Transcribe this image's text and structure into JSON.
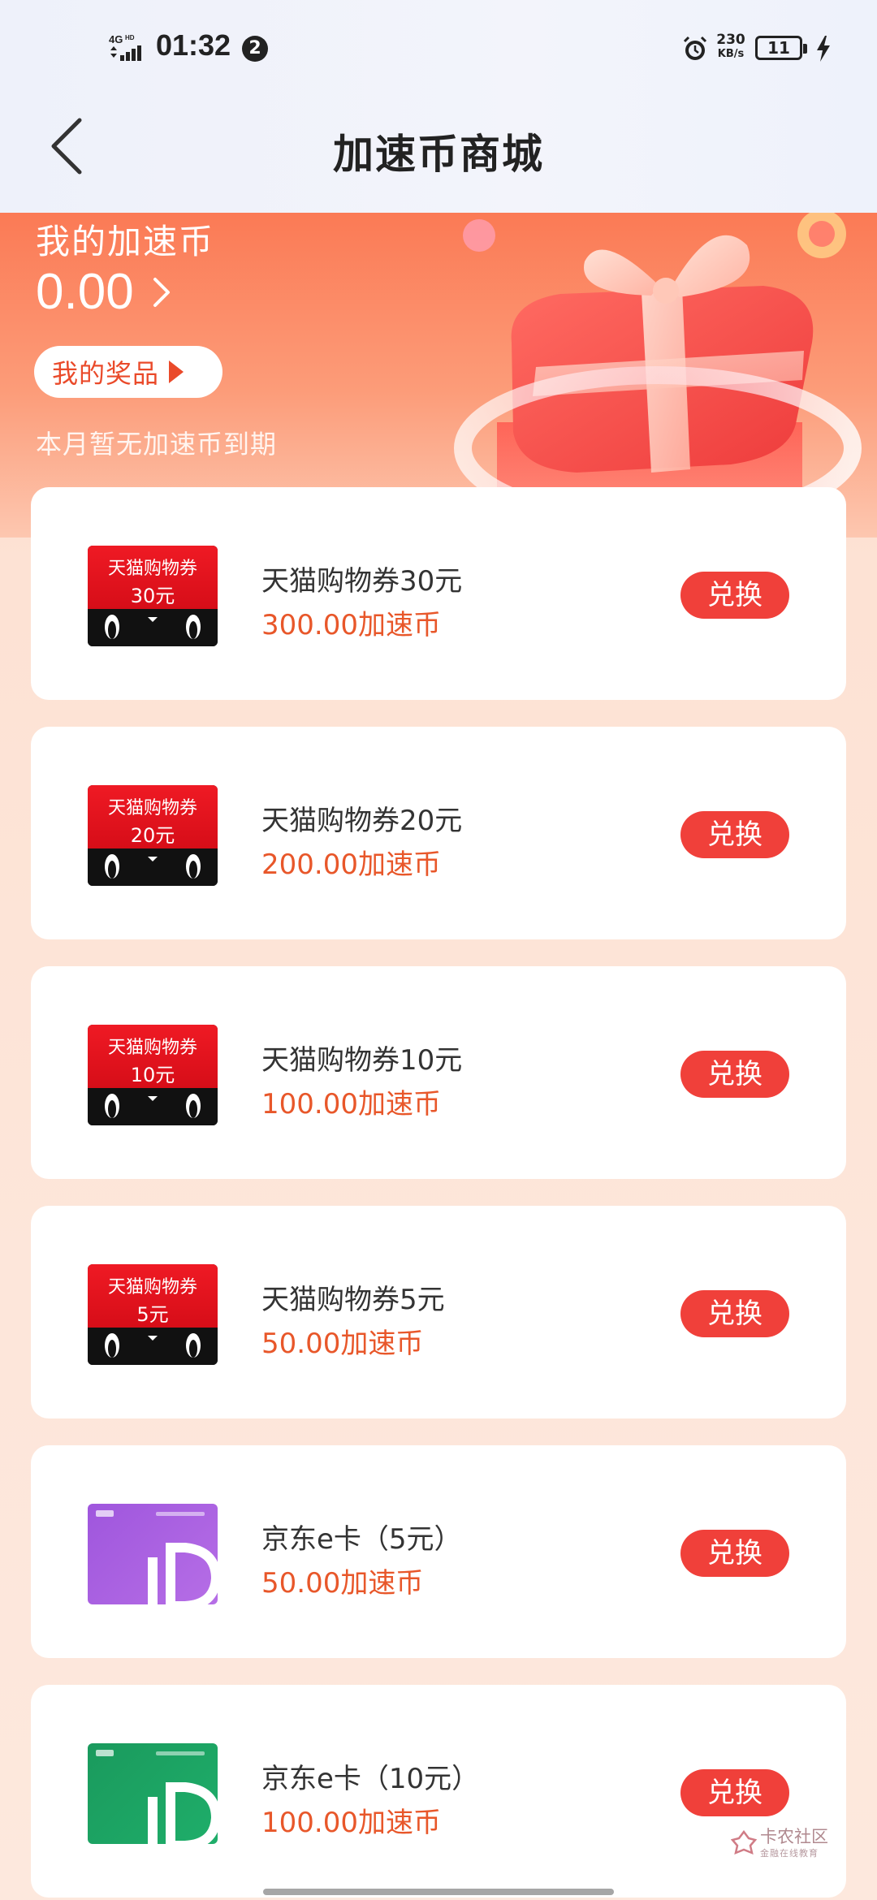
{
  "status_bar": {
    "network": "4GHD",
    "time": "01:32",
    "notification_count": "2",
    "speed_value": "230",
    "speed_unit": "KB/s",
    "battery": "11",
    "icons": [
      "signal-icon",
      "alarm-icon",
      "battery-icon",
      "charging-icon"
    ]
  },
  "header": {
    "title": "加速币商城",
    "back_icon": "chevron-left-icon"
  },
  "banner": {
    "title": "我的加速币",
    "balance": "0.00",
    "my_prizes_label": "我的奖品",
    "expire_note": "本月暂无加速币到期",
    "colors": {
      "gradient_top": "#fb7a55",
      "gradient_bottom": "#fdc7b0"
    }
  },
  "products": [
    {
      "thumb_type": "tmall",
      "thumb_title": "天猫购物券",
      "thumb_value": "30元",
      "name": "天猫购物券30元",
      "price": "300.00加速币",
      "button": "兑换"
    },
    {
      "thumb_type": "tmall",
      "thumb_title": "天猫购物券",
      "thumb_value": "20元",
      "name": "天猫购物券20元",
      "price": "200.00加速币",
      "button": "兑换"
    },
    {
      "thumb_type": "tmall",
      "thumb_title": "天猫购物券",
      "thumb_value": "10元",
      "name": "天猫购物券10元",
      "price": "100.00加速币",
      "button": "兑换"
    },
    {
      "thumb_type": "tmall",
      "thumb_title": "天猫购物券",
      "thumb_value": "5元",
      "name": "天猫购物券5元",
      "price": "50.00加速币",
      "button": "兑换"
    },
    {
      "thumb_type": "jd-purple",
      "name": "京东e卡（5元）",
      "price": "50.00加速币",
      "button": "兑换"
    },
    {
      "thumb_type": "jd-green",
      "name": "京东e卡（10元）",
      "price": "100.00加速币",
      "button": "兑换"
    }
  ],
  "colors": {
    "accent_red": "#f0403a",
    "price_orange": "#e8572a",
    "tmall_red": "#e0101c",
    "jd_purple": "#a95fe0",
    "jd_green": "#1ba463"
  },
  "watermark": {
    "text": "卡农社区",
    "subtext": "金融在线教育"
  }
}
